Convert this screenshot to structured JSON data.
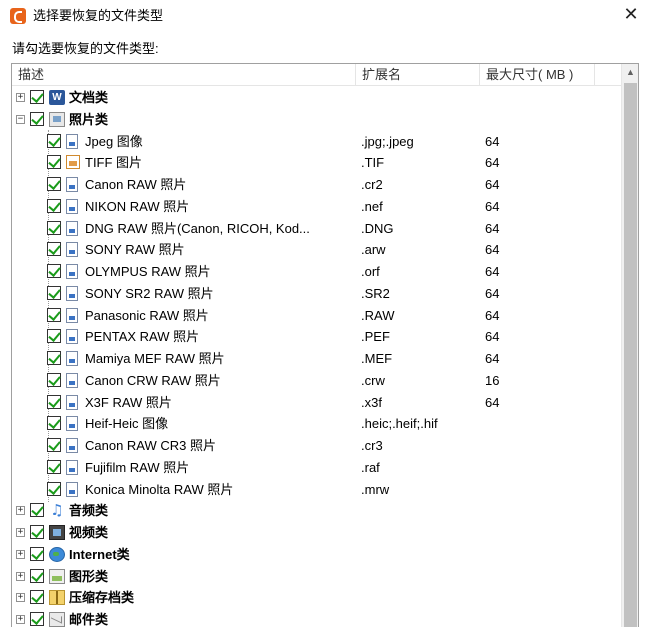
{
  "window": {
    "title": "选择要恢复的文件类型",
    "close_symbol": "✕"
  },
  "prompt": "请勾选要恢复的文件类型:",
  "columns": {
    "desc": "描述",
    "ext": "扩展名",
    "size": "最大尺寸( MB )"
  },
  "tree": {
    "doc": {
      "expander": "+",
      "icon": "word-icon",
      "icon_text": "W",
      "label": "文档类"
    },
    "photo": {
      "expander": "−",
      "icon": "photo-folder-icon",
      "label": "照片类"
    },
    "photo_items": [
      {
        "label": "Jpeg 图像",
        "ext": ".jpg;.jpeg",
        "size": "64",
        "icon": "file-icon"
      },
      {
        "label": "TIFF 图片",
        "ext": ".TIF",
        "size": "64",
        "icon": "tiff-icon"
      },
      {
        "label": "Canon RAW 照片",
        "ext": ".cr2",
        "size": "64",
        "icon": "file-icon"
      },
      {
        "label": "NIKON RAW 照片",
        "ext": ".nef",
        "size": "64",
        "icon": "file-icon"
      },
      {
        "label": "DNG RAW 照片(Canon, RICOH, Kod...",
        "ext": ".DNG",
        "size": "64",
        "icon": "file-icon"
      },
      {
        "label": "SONY RAW 照片",
        "ext": ".arw",
        "size": "64",
        "icon": "file-icon"
      },
      {
        "label": "OLYMPUS RAW 照片",
        "ext": ".orf",
        "size": "64",
        "icon": "file-icon"
      },
      {
        "label": "SONY SR2 RAW 照片",
        "ext": ".SR2",
        "size": "64",
        "icon": "file-icon"
      },
      {
        "label": "Panasonic RAW 照片",
        "ext": ".RAW",
        "size": "64",
        "icon": "file-icon"
      },
      {
        "label": "PENTAX RAW 照片",
        "ext": ".PEF",
        "size": "64",
        "icon": "file-icon"
      },
      {
        "label": "Mamiya MEF RAW 照片",
        "ext": ".MEF",
        "size": "64",
        "icon": "file-icon"
      },
      {
        "label": "Canon CRW RAW 照片",
        "ext": ".crw",
        "size": "16",
        "icon": "file-icon"
      },
      {
        "label": "X3F RAW 照片",
        "ext": ".x3f",
        "size": "64",
        "icon": "file-icon"
      },
      {
        "label": "Heif-Heic 图像",
        "ext": ".heic;.heif;.hif",
        "size": "",
        "icon": "file-icon"
      },
      {
        "label": "Canon RAW CR3 照片",
        "ext": ".cr3",
        "size": "",
        "icon": "file-icon"
      },
      {
        "label": "Fujifilm RAW 照片",
        "ext": ".raf",
        "size": "",
        "icon": "file-icon"
      },
      {
        "label": "Konica Minolta RAW 照片",
        "ext": ".mrw",
        "size": "",
        "icon": "file-icon"
      }
    ],
    "audio": {
      "expander": "+",
      "icon": "music-note-icon",
      "icon_text": "♫",
      "label": "音频类"
    },
    "video": {
      "expander": "+",
      "icon": "video-icon",
      "label": "视频类"
    },
    "internet": {
      "expander": "+",
      "icon": "globe-icon",
      "label": "Internet类"
    },
    "graphics": {
      "expander": "+",
      "icon": "graphics-icon",
      "label": "图形类"
    },
    "archive": {
      "expander": "+",
      "icon": "archive-icon",
      "label": "压缩存档类"
    },
    "mail": {
      "expander": "+",
      "icon": "mail-icon",
      "label": "邮件类"
    }
  },
  "scrollbar": {
    "up_symbol": "▲"
  }
}
